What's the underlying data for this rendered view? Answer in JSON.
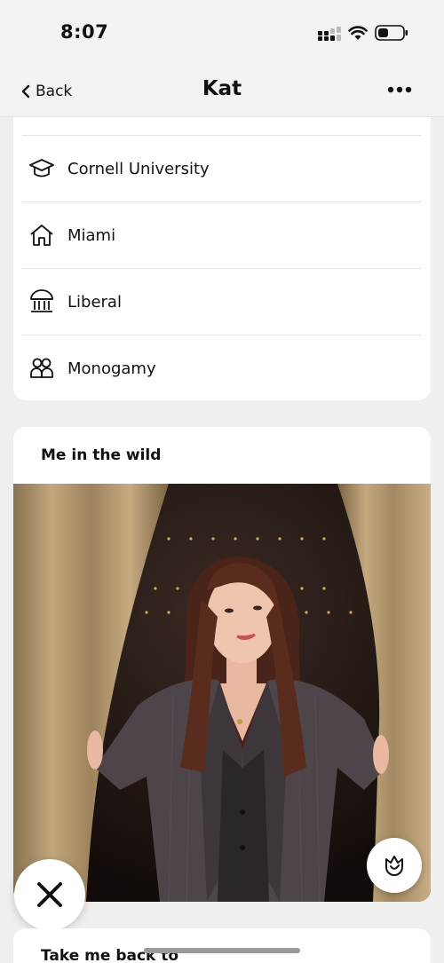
{
  "status": {
    "time": "8:07"
  },
  "nav": {
    "back_label": "Back",
    "title": "Kat"
  },
  "details": [
    {
      "icon": "graduation-cap-icon",
      "label": "Cornell University"
    },
    {
      "icon": "home-icon",
      "label": "Miami"
    },
    {
      "icon": "politics-building-icon",
      "label": "Liberal"
    },
    {
      "icon": "people-icon",
      "label": "Monogamy"
    }
  ],
  "prompt_card": {
    "title": "Me in the wild"
  },
  "next_card": {
    "title": "Take me back to"
  },
  "colors": {
    "accent": "#111111",
    "background": "#efefef",
    "card": "#ffffff"
  }
}
